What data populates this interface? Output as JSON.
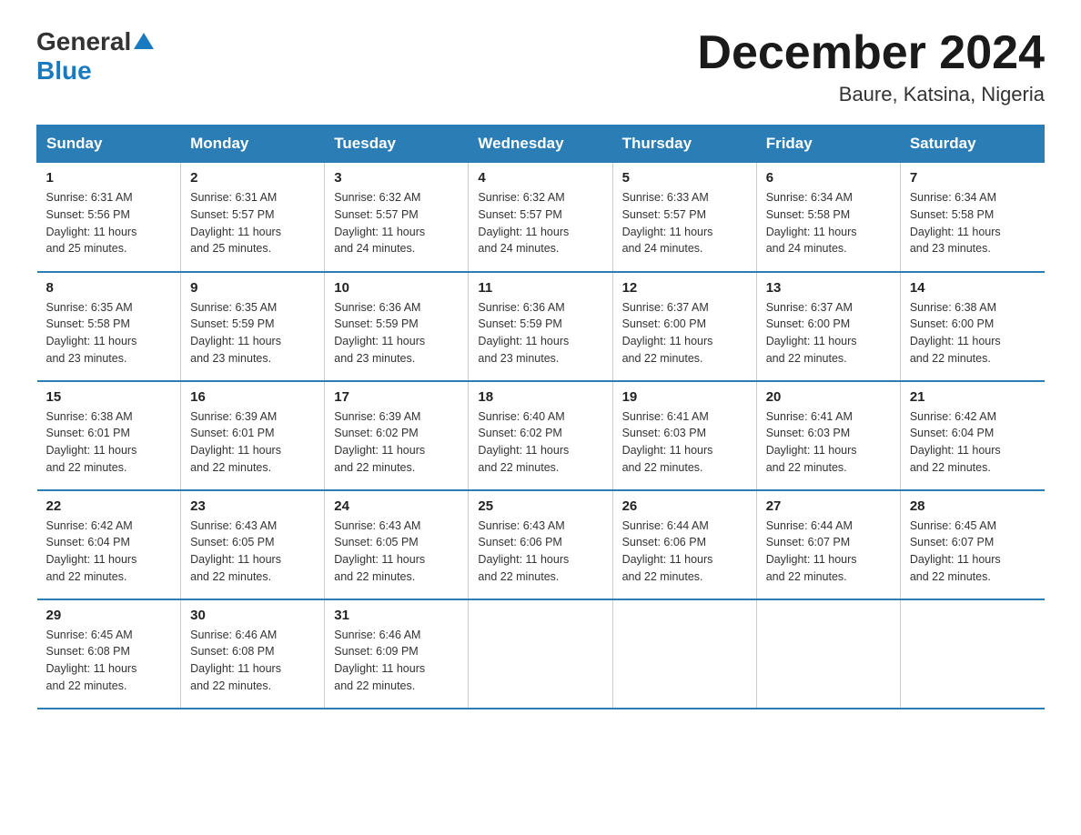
{
  "header": {
    "logo_general": "General",
    "logo_blue": "Blue",
    "month_title": "December 2024",
    "location": "Baure, Katsina, Nigeria"
  },
  "days_of_week": [
    "Sunday",
    "Monday",
    "Tuesday",
    "Wednesday",
    "Thursday",
    "Friday",
    "Saturday"
  ],
  "weeks": [
    [
      {
        "day": "1",
        "sunrise": "6:31 AM",
        "sunset": "5:56 PM",
        "daylight": "11 hours and 25 minutes."
      },
      {
        "day": "2",
        "sunrise": "6:31 AM",
        "sunset": "5:57 PM",
        "daylight": "11 hours and 25 minutes."
      },
      {
        "day": "3",
        "sunrise": "6:32 AM",
        "sunset": "5:57 PM",
        "daylight": "11 hours and 24 minutes."
      },
      {
        "day": "4",
        "sunrise": "6:32 AM",
        "sunset": "5:57 PM",
        "daylight": "11 hours and 24 minutes."
      },
      {
        "day": "5",
        "sunrise": "6:33 AM",
        "sunset": "5:57 PM",
        "daylight": "11 hours and 24 minutes."
      },
      {
        "day": "6",
        "sunrise": "6:34 AM",
        "sunset": "5:58 PM",
        "daylight": "11 hours and 24 minutes."
      },
      {
        "day": "7",
        "sunrise": "6:34 AM",
        "sunset": "5:58 PM",
        "daylight": "11 hours and 23 minutes."
      }
    ],
    [
      {
        "day": "8",
        "sunrise": "6:35 AM",
        "sunset": "5:58 PM",
        "daylight": "11 hours and 23 minutes."
      },
      {
        "day": "9",
        "sunrise": "6:35 AM",
        "sunset": "5:59 PM",
        "daylight": "11 hours and 23 minutes."
      },
      {
        "day": "10",
        "sunrise": "6:36 AM",
        "sunset": "5:59 PM",
        "daylight": "11 hours and 23 minutes."
      },
      {
        "day": "11",
        "sunrise": "6:36 AM",
        "sunset": "5:59 PM",
        "daylight": "11 hours and 23 minutes."
      },
      {
        "day": "12",
        "sunrise": "6:37 AM",
        "sunset": "6:00 PM",
        "daylight": "11 hours and 22 minutes."
      },
      {
        "day": "13",
        "sunrise": "6:37 AM",
        "sunset": "6:00 PM",
        "daylight": "11 hours and 22 minutes."
      },
      {
        "day": "14",
        "sunrise": "6:38 AM",
        "sunset": "6:00 PM",
        "daylight": "11 hours and 22 minutes."
      }
    ],
    [
      {
        "day": "15",
        "sunrise": "6:38 AM",
        "sunset": "6:01 PM",
        "daylight": "11 hours and 22 minutes."
      },
      {
        "day": "16",
        "sunrise": "6:39 AM",
        "sunset": "6:01 PM",
        "daylight": "11 hours and 22 minutes."
      },
      {
        "day": "17",
        "sunrise": "6:39 AM",
        "sunset": "6:02 PM",
        "daylight": "11 hours and 22 minutes."
      },
      {
        "day": "18",
        "sunrise": "6:40 AM",
        "sunset": "6:02 PM",
        "daylight": "11 hours and 22 minutes."
      },
      {
        "day": "19",
        "sunrise": "6:41 AM",
        "sunset": "6:03 PM",
        "daylight": "11 hours and 22 minutes."
      },
      {
        "day": "20",
        "sunrise": "6:41 AM",
        "sunset": "6:03 PM",
        "daylight": "11 hours and 22 minutes."
      },
      {
        "day": "21",
        "sunrise": "6:42 AM",
        "sunset": "6:04 PM",
        "daylight": "11 hours and 22 minutes."
      }
    ],
    [
      {
        "day": "22",
        "sunrise": "6:42 AM",
        "sunset": "6:04 PM",
        "daylight": "11 hours and 22 minutes."
      },
      {
        "day": "23",
        "sunrise": "6:43 AM",
        "sunset": "6:05 PM",
        "daylight": "11 hours and 22 minutes."
      },
      {
        "day": "24",
        "sunrise": "6:43 AM",
        "sunset": "6:05 PM",
        "daylight": "11 hours and 22 minutes."
      },
      {
        "day": "25",
        "sunrise": "6:43 AM",
        "sunset": "6:06 PM",
        "daylight": "11 hours and 22 minutes."
      },
      {
        "day": "26",
        "sunrise": "6:44 AM",
        "sunset": "6:06 PM",
        "daylight": "11 hours and 22 minutes."
      },
      {
        "day": "27",
        "sunrise": "6:44 AM",
        "sunset": "6:07 PM",
        "daylight": "11 hours and 22 minutes."
      },
      {
        "day": "28",
        "sunrise": "6:45 AM",
        "sunset": "6:07 PM",
        "daylight": "11 hours and 22 minutes."
      }
    ],
    [
      {
        "day": "29",
        "sunrise": "6:45 AM",
        "sunset": "6:08 PM",
        "daylight": "11 hours and 22 minutes."
      },
      {
        "day": "30",
        "sunrise": "6:46 AM",
        "sunset": "6:08 PM",
        "daylight": "11 hours and 22 minutes."
      },
      {
        "day": "31",
        "sunrise": "6:46 AM",
        "sunset": "6:09 PM",
        "daylight": "11 hours and 22 minutes."
      },
      null,
      null,
      null,
      null
    ]
  ],
  "labels": {
    "sunrise": "Sunrise:",
    "sunset": "Sunset:",
    "daylight": "Daylight:"
  }
}
